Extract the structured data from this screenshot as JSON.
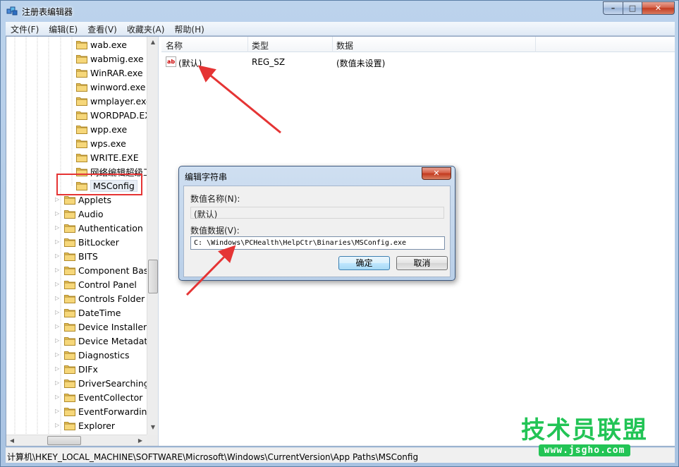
{
  "window": {
    "title": "注册表编辑器"
  },
  "caption_buttons": {
    "minimize": "–",
    "maximize": "□",
    "close": "✕"
  },
  "menu": [
    "文件(F)",
    "编辑(E)",
    "查看(V)",
    "收藏夹(A)",
    "帮助(H)"
  ],
  "tree": {
    "sub_items": [
      "wab.exe",
      "wabmig.exe",
      "WinRAR.exe",
      "winword.exe",
      "wmplayer.exe",
      "WORDPAD.EX",
      "wpp.exe",
      "wps.exe",
      "WRITE.EXE",
      "网络编辑超级工"
    ],
    "selected": "MSConfig",
    "items": [
      "Applets",
      "Audio",
      "Authentication",
      "BitLocker",
      "BITS",
      "Component Base",
      "Control Panel",
      "Controls Folder",
      "DateTime",
      "Device Installer",
      "Device Metadata",
      "Diagnostics",
      "DIFx",
      "DriverSearching",
      "EventCollector",
      "EventForwarding",
      "Explorer"
    ]
  },
  "list": {
    "columns": [
      "名称",
      "类型",
      "数据"
    ],
    "rows": [
      {
        "name": "(默认)",
        "type": "REG_SZ",
        "data": "(数值未设置)",
        "icon": "ab-string-icon"
      }
    ]
  },
  "status": {
    "path": "计算机\\HKEY_LOCAL_MACHINE\\SOFTWARE\\Microsoft\\Windows\\CurrentVersion\\App Paths\\MSConfig"
  },
  "dialog": {
    "title": "编辑字符串",
    "name_label": "数值名称(N):",
    "name_value": "(默认)",
    "data_label": "数值数据(V):",
    "data_value": "C: \\Windows\\PCHealth\\HelpCtr\\Binaries\\MSConfig.exe",
    "ok": "确定",
    "cancel": "取消",
    "close": "✕"
  },
  "watermark": {
    "text": "技术员联盟",
    "url": "www.jsgho.com"
  },
  "colors": {
    "annotation": "#e53434",
    "watermark": "#22c455",
    "folder": "#e8c35a"
  }
}
